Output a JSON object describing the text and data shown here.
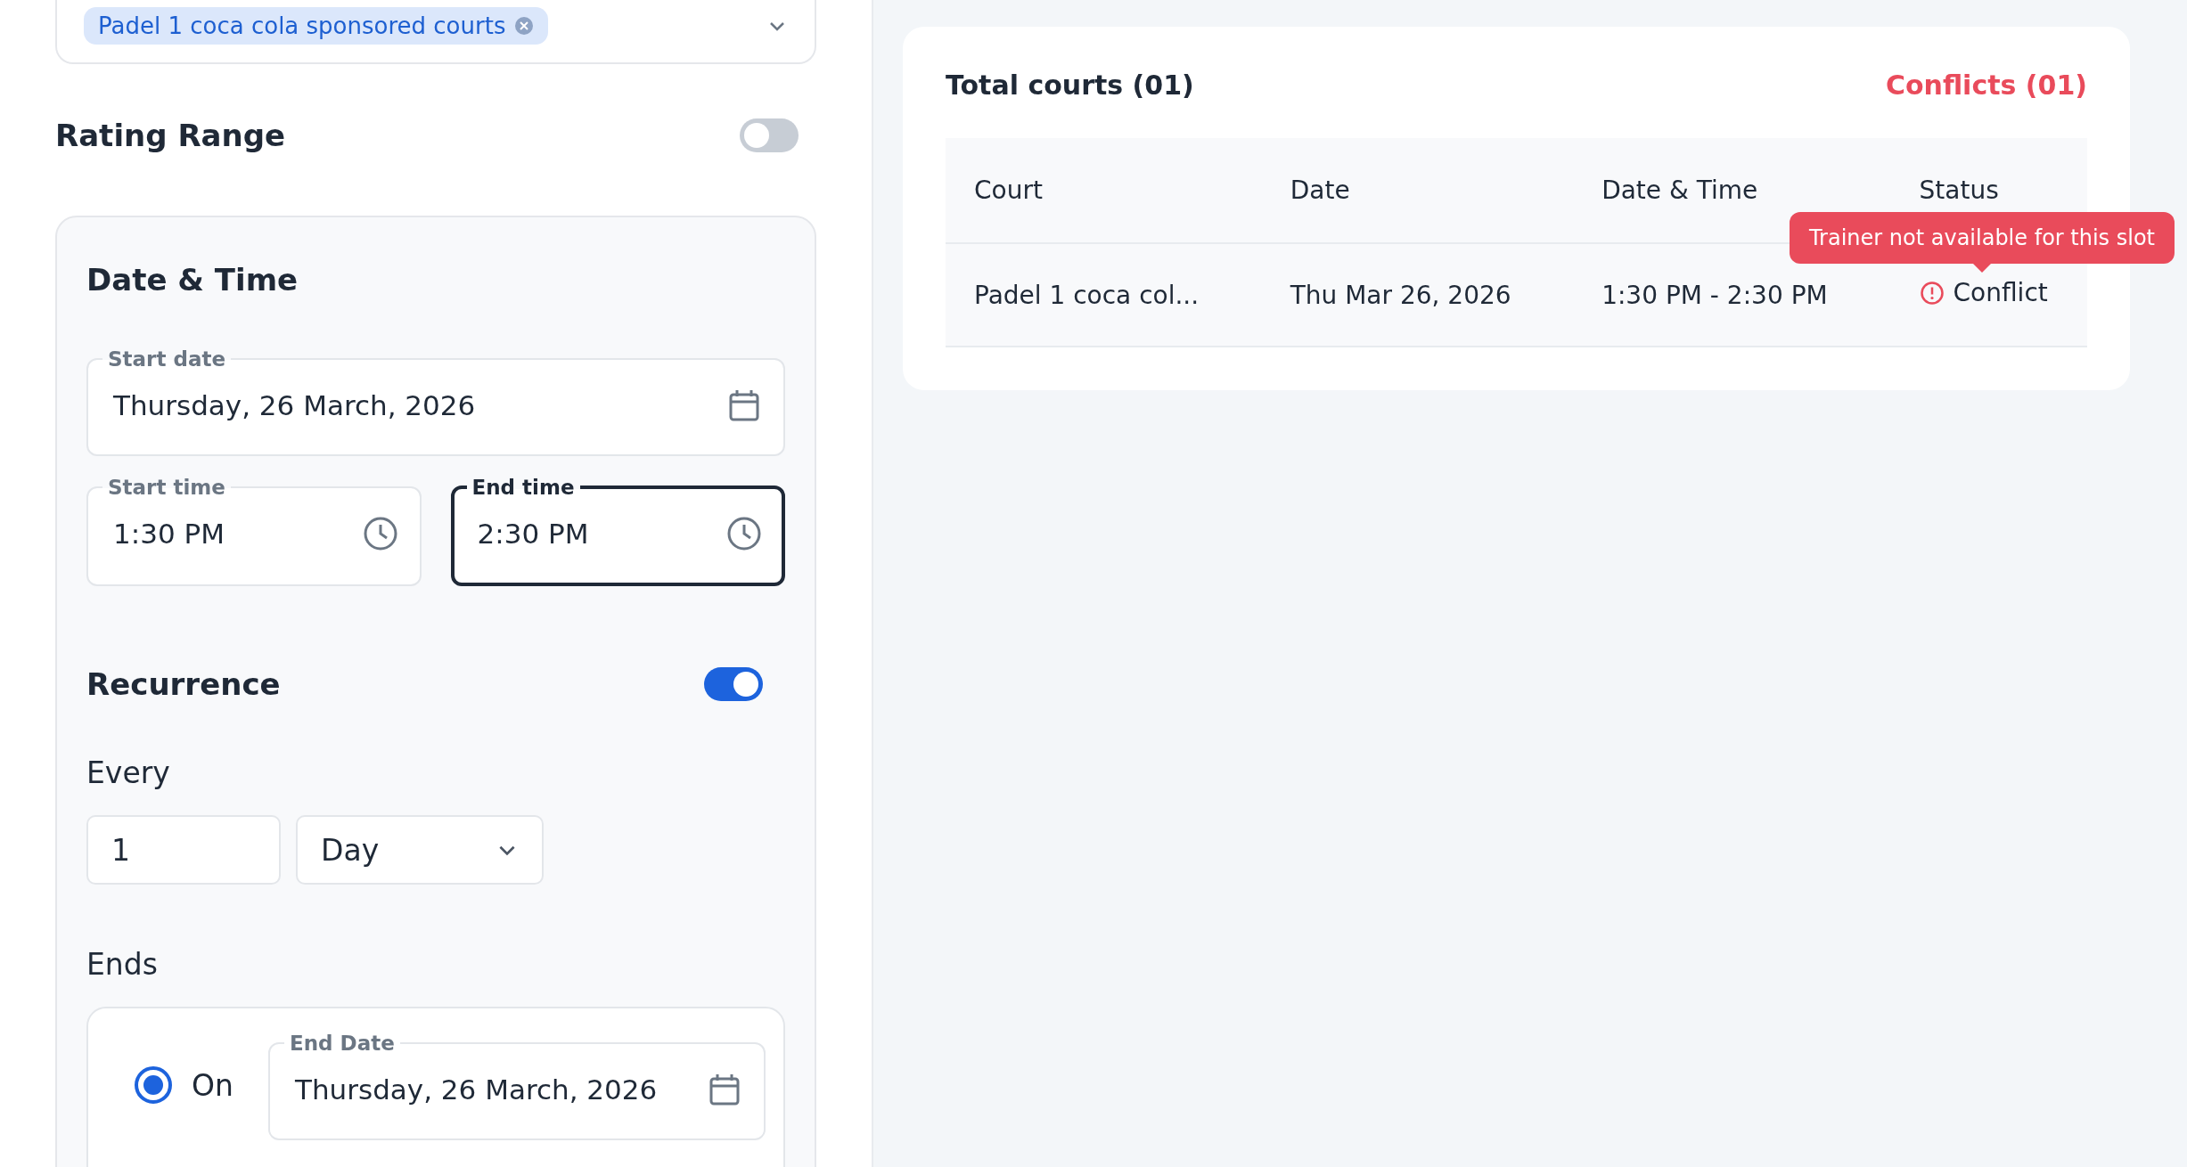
{
  "courts_field": {
    "chips": [
      "Padel 1 coca cola sponsored courts"
    ]
  },
  "rating_range": {
    "title": "Rating Range",
    "on": false
  },
  "date_time": {
    "title": "Date & Time",
    "start_date": {
      "label": "Start date",
      "value": "Thursday, 26 March, 2026"
    },
    "start_time": {
      "label": "Start time",
      "value": "1:30 PM",
      "focused": false
    },
    "end_time": {
      "label": "End time",
      "value": "2:30 PM",
      "focused": true
    },
    "recurrence": {
      "title": "Recurrence",
      "on": true
    },
    "every": {
      "label": "Every",
      "count": "1",
      "unit": "Day"
    },
    "ends": {
      "label": "Ends",
      "options": [
        {
          "label": "On",
          "selected": true
        }
      ],
      "end_date": {
        "label": "End Date",
        "value": "Thursday, 26 March, 2026"
      }
    }
  },
  "summary": {
    "total": "Total courts (01)",
    "conflicts": "Conflicts (01)",
    "table": {
      "columns": [
        "Court",
        "Date",
        "Date & Time",
        "Status"
      ],
      "rows": [
        {
          "court": "Padel 1 coca col...",
          "date": "Thu Mar 26, 2026",
          "time": "1:30 PM - 2:30 PM",
          "status": "Conflict",
          "conflict": true
        }
      ]
    },
    "tooltip": "Trainer not available for this slot"
  }
}
